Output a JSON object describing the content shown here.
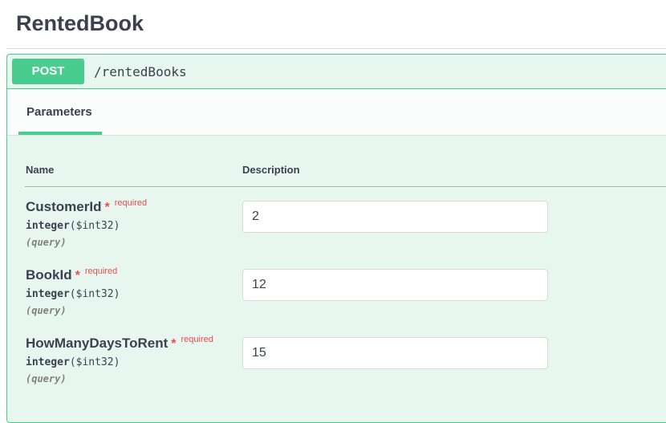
{
  "section": {
    "title": "RentedBook"
  },
  "operation": {
    "method": "POST",
    "path": "/rentedBooks"
  },
  "tabs": {
    "parameters_label": "Parameters"
  },
  "table": {
    "name_header": "Name",
    "description_header": "Description"
  },
  "params": [
    {
      "name": "CustomerId",
      "star": "*",
      "required": "required",
      "type": "integer",
      "format": "($int32)",
      "in": "(query)",
      "value": "2"
    },
    {
      "name": "BookId",
      "star": "*",
      "required": "required",
      "type": "integer",
      "format": "($int32)",
      "in": "(query)",
      "value": "12"
    },
    {
      "name": "HowManyDaysToRent",
      "star": "*",
      "required": "required",
      "type": "integer",
      "format": "($int32)",
      "in": "(query)",
      "value": "15"
    }
  ],
  "colors": {
    "post_green": "#49cc90",
    "opblock_bg": "#e8f6f0",
    "required_red": "#e94f4f",
    "text_dark": "#3b4151"
  }
}
